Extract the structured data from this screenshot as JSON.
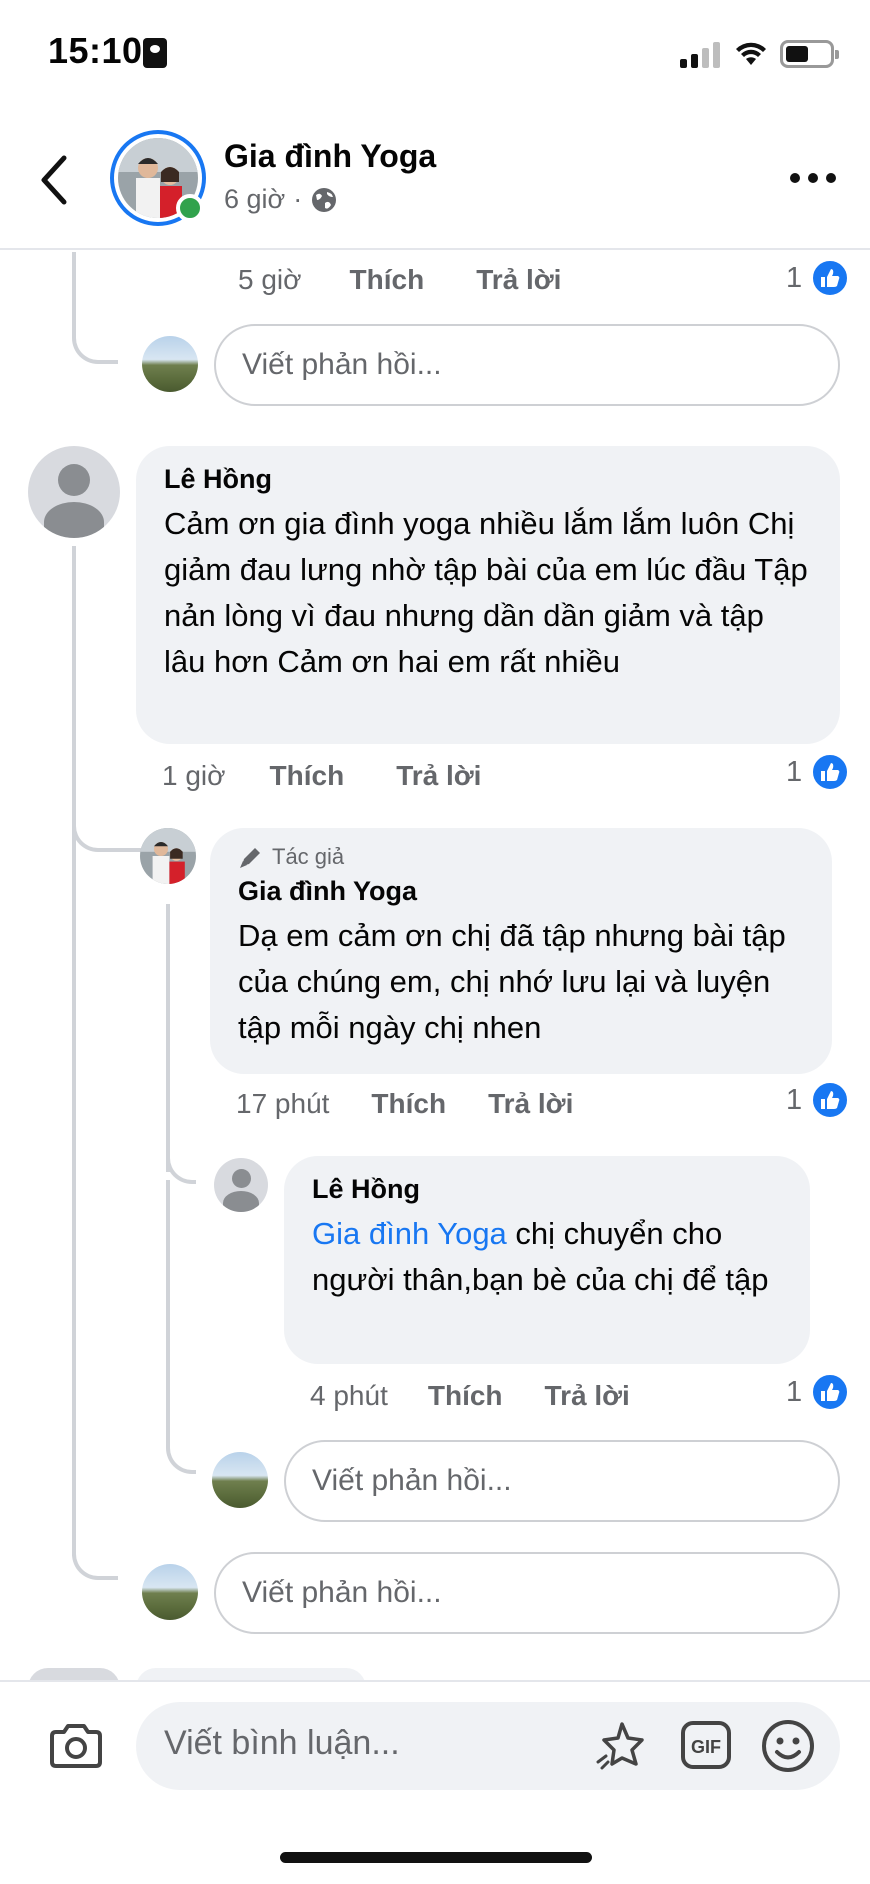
{
  "status_bar": {
    "time": "15:10"
  },
  "header": {
    "title": "Gia đình Yoga",
    "time": "6 giờ",
    "separator": "·"
  },
  "prev_comment_tail": {
    "time": "5 giờ",
    "like": "Thích",
    "reply": "Trả lời",
    "like_count": "1"
  },
  "reply_placeholder": "Viết phản hồi...",
  "comment": {
    "author": "Lê Hồng",
    "text": "Cảm ơn gia đình yoga nhiều lắm lắm luôn Chị giảm đau lưng nhờ tập bài của em lúc đầu Tập nản lòng vì đau nhưng dần dần giảm và tập lâu hơn Cảm ơn hai em rất nhiều",
    "time": "1 giờ",
    "like": "Thích",
    "reply": "Trả lời",
    "like_count": "1"
  },
  "reply1": {
    "badge": "Tác giả",
    "author": "Gia đình Yoga",
    "text": "Dạ em cảm ơn chị đã tập nhưng bài tập của chúng em, chị nhớ lưu lại và luyện tập mỗi ngày chị nhen",
    "time": "17 phút",
    "like": "Thích",
    "reply": "Trả lời",
    "like_count": "1"
  },
  "reply2": {
    "author": "Lê Hồng",
    "mention": "Gia đình Yoga",
    "text": " chị chuyển cho người thân,bạn bè của chị để tập",
    "time": "4 phút",
    "like": "Thích",
    "reply": "Trả lời",
    "like_count": "1"
  },
  "composer": {
    "placeholder": "Viết bình luận..."
  },
  "colors": {
    "accent": "#1877f2",
    "bubble": "#f0f2f5",
    "muted": "#65676b",
    "online": "#31a24c"
  }
}
